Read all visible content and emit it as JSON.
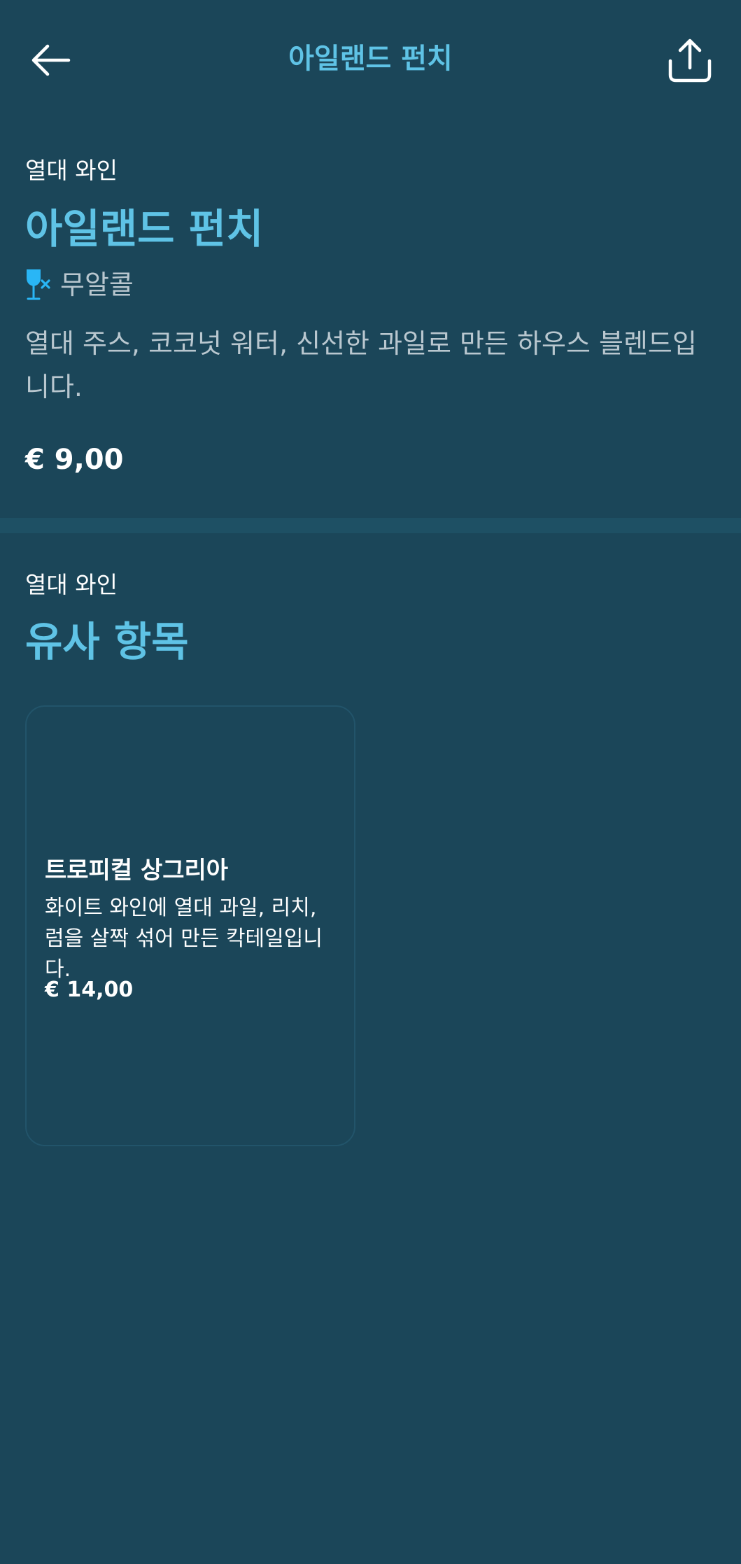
{
  "header": {
    "title": "아일랜드 펀치",
    "back_icon": "arrow-left-icon",
    "share_icon": "share-icon"
  },
  "product": {
    "category": "열대 와인",
    "name": "아일랜드 펀치",
    "tag_icon": "no-alcohol-glass-icon",
    "tag": "무알콜",
    "description": "열대 주스, 코코넛 워터, 신선한 과일로 만든 하우스 블렌드입니다.",
    "price": "€ 9,00"
  },
  "similar": {
    "category": "열대 와인",
    "title": "유사 항목",
    "items": [
      {
        "name": "트로피컬 상그리아",
        "description": "화이트 와인에 열대 과일, 리치, 럼을 살짝 섞어 만든 칵테일입니다.",
        "price": "€ 14,00"
      }
    ]
  },
  "colors": {
    "background": "#1b4659",
    "accent": "#5fc3e6",
    "icon_accent": "#29b6f6",
    "muted_text": "#b9c7cf",
    "divider": "#1e5064"
  }
}
